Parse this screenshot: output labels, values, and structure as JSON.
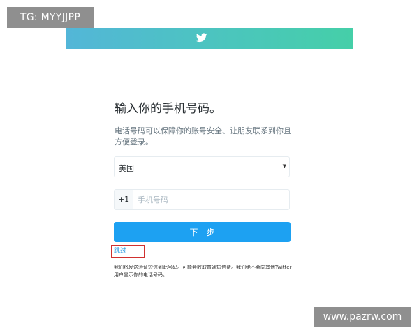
{
  "badge": {
    "text": "TG: MYYJJPP"
  },
  "header": {
    "logo_icon": "twitter-bird-icon",
    "gradient_colors": [
      "#53b6d8",
      "#45cfa8"
    ]
  },
  "form": {
    "title": "输入你的手机号码。",
    "description": "电话号码可以保障你的账号安全、让朋友联系到你且方便登录。",
    "country": {
      "selected": "美国"
    },
    "phone": {
      "country_code": "+1",
      "placeholder": "手机号码",
      "value": ""
    },
    "next_label": "下一步",
    "skip_label": "跳过",
    "disclaimer": "我们将发送验证短信到此号码。可能会收取普通短信费。我们绝不会向其他Twitter 用户显示你的电话号码。"
  },
  "watermark": {
    "text": "www.pazrw.com"
  },
  "colors": {
    "primary": "#1da1f2",
    "link": "#1b95e0",
    "highlight_border": "#d0312f"
  }
}
